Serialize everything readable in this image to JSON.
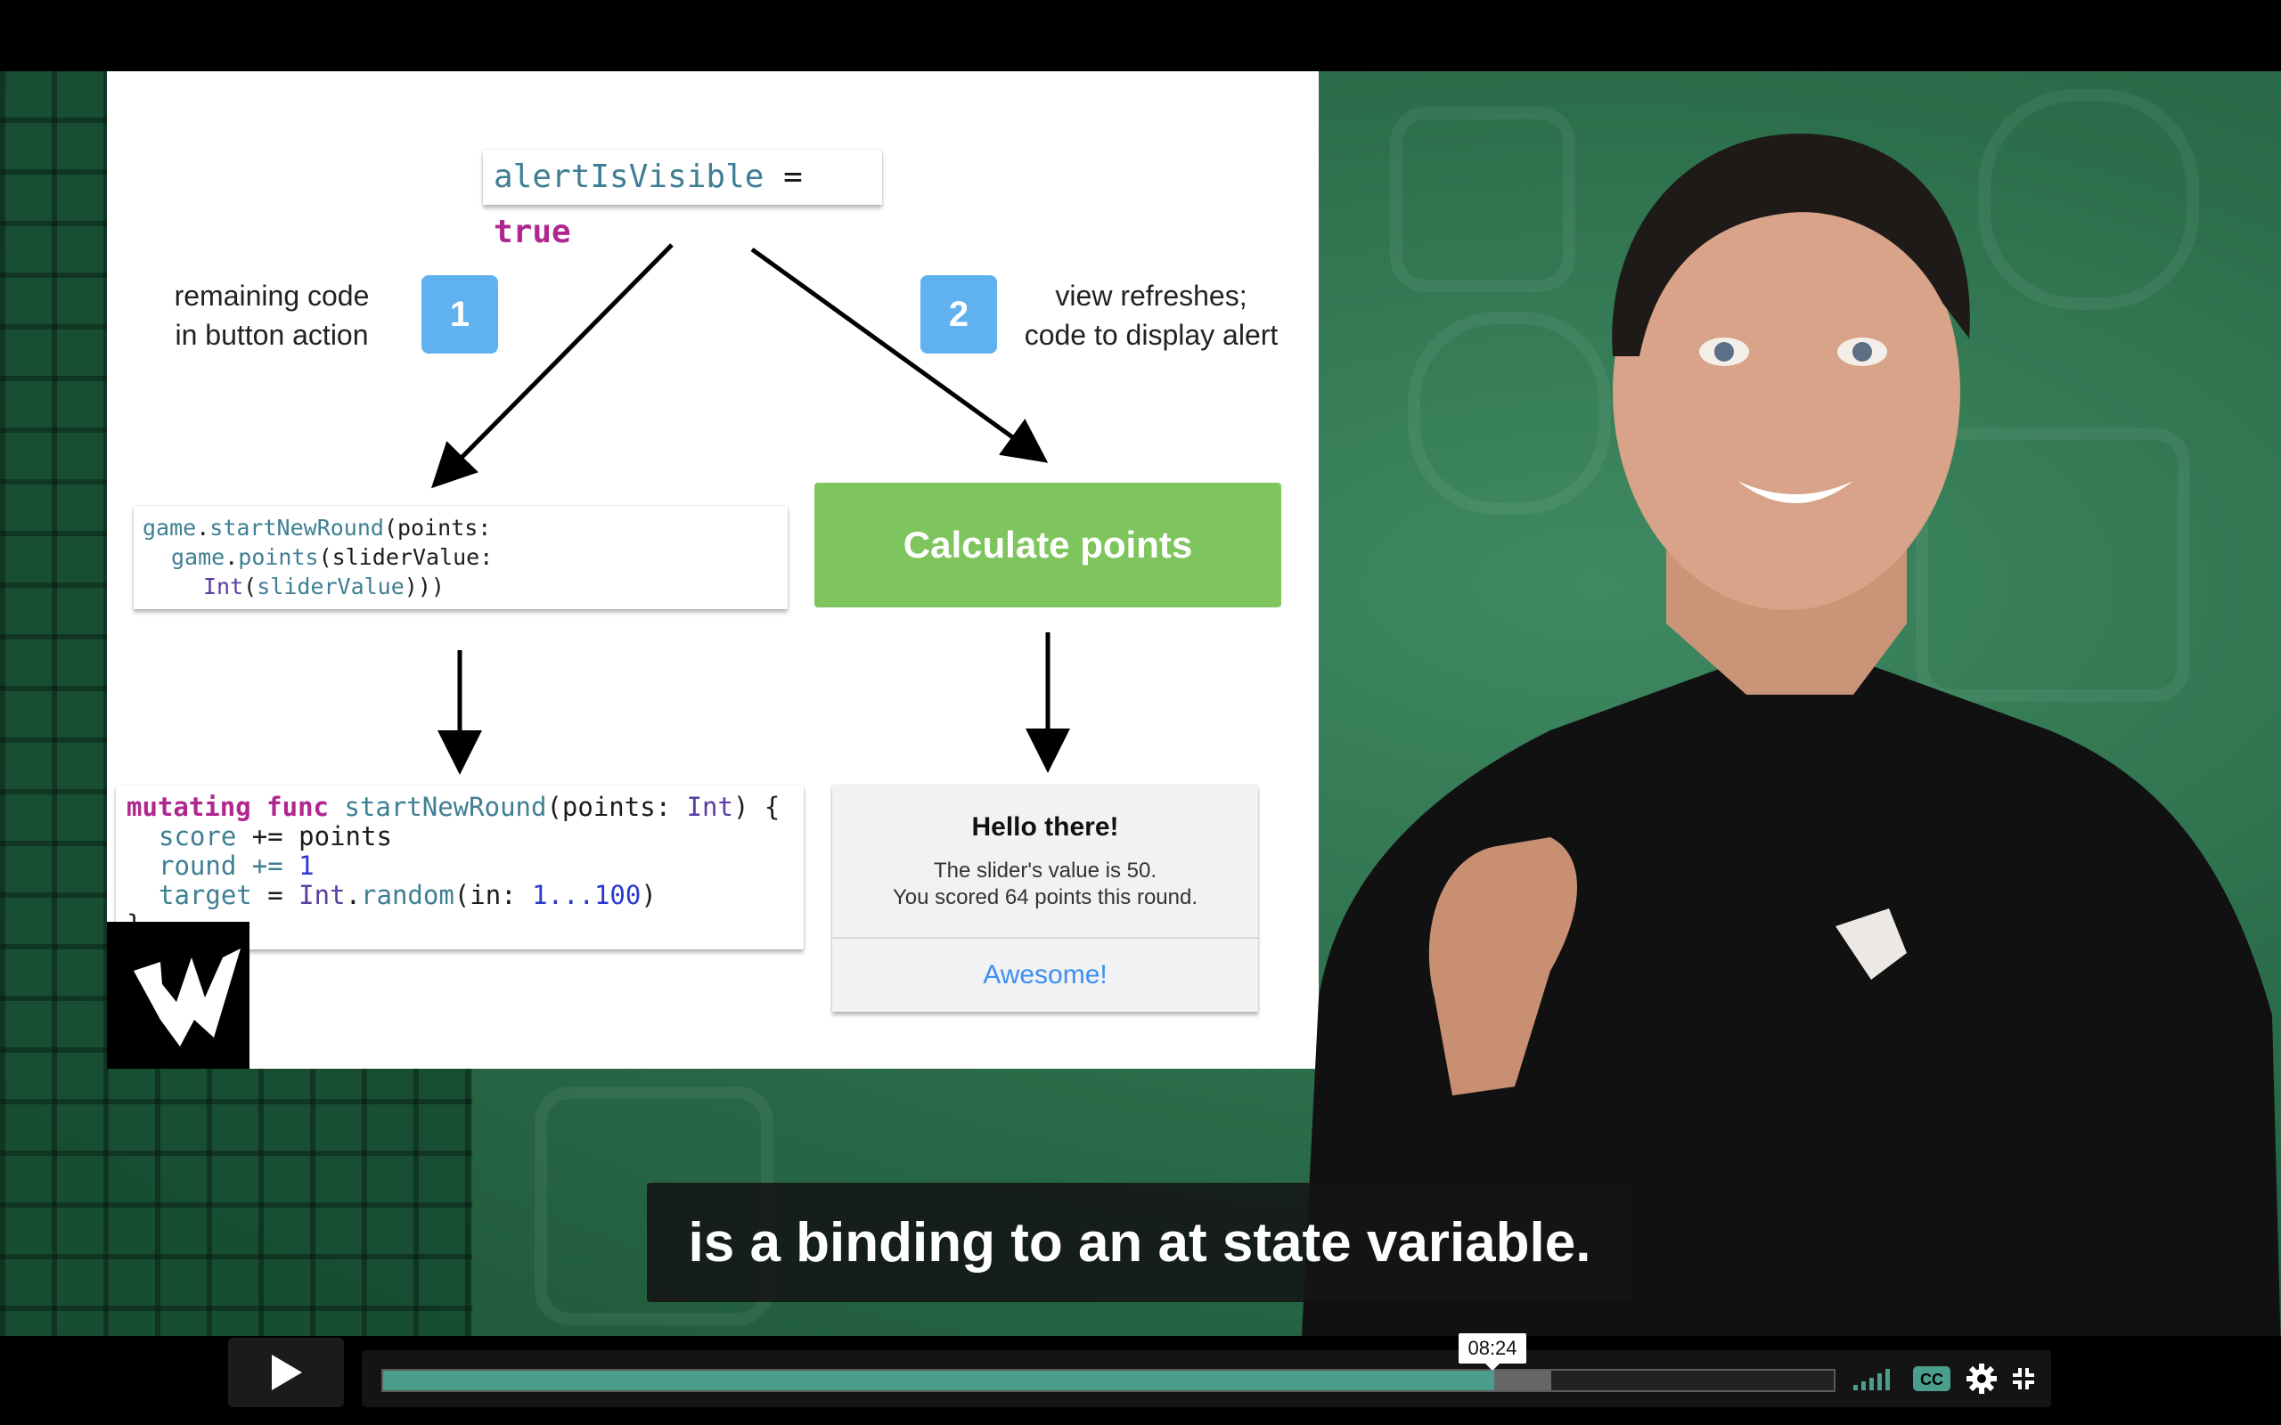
{
  "slide": {
    "top_code": {
      "var": "alertIsVisible",
      "op": "=",
      "val": "true"
    },
    "step1": {
      "number": "1",
      "label_line1": "remaining code",
      "label_line2": "in button action"
    },
    "step2": {
      "number": "2",
      "label_line1": "view refreshes;",
      "label_line2": "code to display alert"
    },
    "left_code": {
      "l1a": "game",
      "l1b": ".",
      "l1c": "startNewRound",
      "l1d": "(points:",
      "l2a": "game",
      "l2b": ".",
      "l2c": "points",
      "l2d": "(sliderValue:",
      "l3a": "Int",
      "l3b": "(",
      "l3c": "sliderValue",
      "l3d": ")))"
    },
    "calc_button": "Calculate points",
    "func_code": {
      "kw1": "mutating",
      "kw2": "func",
      "name": "startNewRound",
      "params_a": "(points: ",
      "params_type": "Int",
      "params_b": ") {",
      "s1a": "score",
      "s1b": "+=",
      "s1c": "points",
      "s2a": "round",
      "s2b": "+=",
      "s2c": "1",
      "s3a": "target",
      "s3b": "=",
      "s3c": "Int",
      "s3d": ".",
      "s3e": "random",
      "s3f": "(in: ",
      "s3g": "1...100",
      "s3h": ")",
      "close": "}"
    },
    "alert": {
      "title": "Hello there!",
      "msg1": "The slider's value is 50.",
      "msg2": "You scored 64 points this round.",
      "button": "Awesome!"
    }
  },
  "caption": "is a binding to an at state variable.",
  "player": {
    "time_tooltip": "08:24",
    "progress_played": 0.766,
    "progress_buffered": 0.805,
    "icons": [
      "play-icon",
      "volume-icon",
      "cc-icon",
      "settings-icon",
      "fullscreen-exit-icon"
    ],
    "accent_color": "#4b9e8b"
  }
}
